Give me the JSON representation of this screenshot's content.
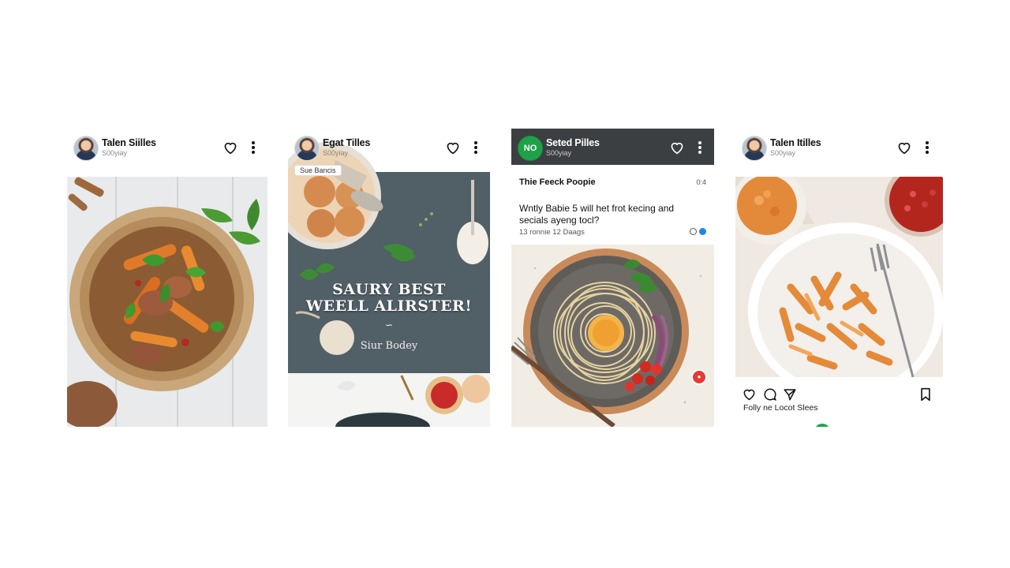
{
  "colors": {
    "background": "#ffffff",
    "dark_header": "#3c3f42",
    "brand_green": "#1fa14a",
    "accent_blue": "#1e88e5",
    "accent_red": "#e53935"
  },
  "posts": [
    {
      "author": "Talen Siilles",
      "subtitle": "S00yiay",
      "icons": [
        "avatar",
        "heart-icon",
        "more-vertical-icon"
      ],
      "media": "bowl-of-roasted-vegetables-with-basil"
    },
    {
      "author": "Egat Tilles",
      "subtitle": "S00yiay",
      "tag": "Sue Bancis",
      "icons": [
        "avatar",
        "heart-icon",
        "more-vertical-icon"
      ],
      "poster": {
        "title_line1": "SAURY BEST",
        "title_line2": "WEELL ALIRSTER!",
        "divider": "∽",
        "subtitle": "Siur Bodey"
      }
    },
    {
      "author": "Seted Pilles",
      "subtitle": "S00yiay",
      "avatar_text": "NO",
      "icons": [
        "brand-avatar",
        "heart-icon",
        "more-vertical-icon",
        "like-badge-icon"
      ],
      "article": {
        "title": "Thie Feeck Poopie",
        "count": "0:4",
        "text": "Wntly Babie 5 will het frot kecing and secials ayeng tocl?",
        "meta": "13 ronnie 12 Daags"
      },
      "media": "spaghetti-nest-with-egg-yolk"
    },
    {
      "author": "Talen Itilles",
      "subtitle": "S00yiay",
      "icons": [
        "avatar",
        "heart-icon",
        "more-vertical-icon",
        "comment-icon",
        "share-icon",
        "bookmark-icon"
      ],
      "media": "bowl-of-seasoned-pasta-with-fork",
      "likes_text": "Folly ne Locot Slees"
    }
  ]
}
